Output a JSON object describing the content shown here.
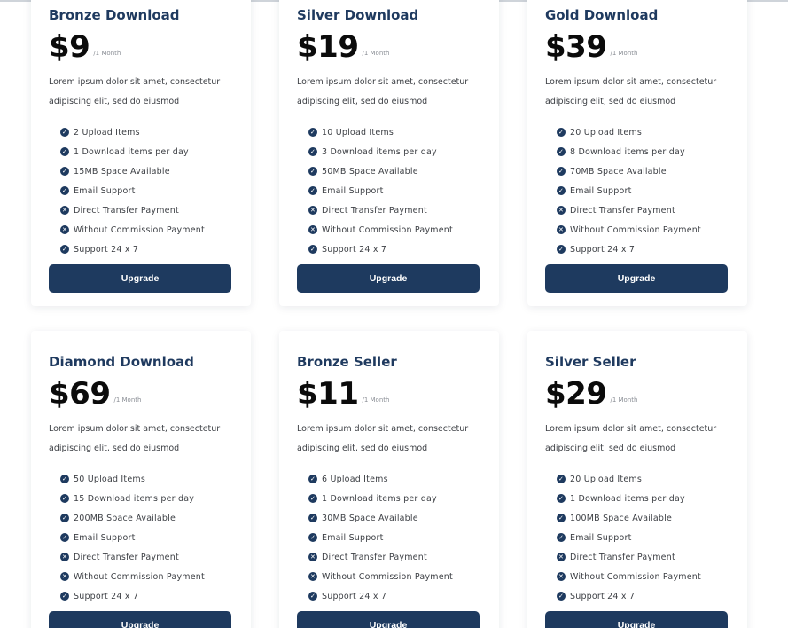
{
  "colors": {
    "primary": "#1e3a5f",
    "plan_name": "#1f3a5f",
    "price": "#0b0b0b",
    "muted": "#8b8f96"
  },
  "plans": [
    {
      "name": "Bronze Download",
      "price": "$9",
      "period": "/1 Month",
      "description": "Lorem ipsum dolor sit amet, consectetur adipiscing elit, sed do eiusmod",
      "button_label": "Upgrade",
      "features": [
        {
          "text": "2 Upload Items",
          "icon": "check-circle-icon"
        },
        {
          "text": "1 Download items per day",
          "icon": "check-circle-icon"
        },
        {
          "text": "15MB Space Available",
          "icon": "check-circle-icon"
        },
        {
          "text": "Email Support",
          "icon": "check-circle-icon"
        },
        {
          "text": "Direct Transfer Payment",
          "icon": "x-circle-icon"
        },
        {
          "text": "Without Commission Payment",
          "icon": "x-circle-icon"
        },
        {
          "text": "Support 24 x 7",
          "icon": "check-circle-icon"
        }
      ]
    },
    {
      "name": "Silver Download",
      "price": "$19",
      "period": "/1 Month",
      "description": "Lorem ipsum dolor sit amet, consectetur adipiscing elit, sed do eiusmod",
      "button_label": "Upgrade",
      "features": [
        {
          "text": "10 Upload Items",
          "icon": "check-circle-icon"
        },
        {
          "text": "3 Download items per day",
          "icon": "check-circle-icon"
        },
        {
          "text": "50MB Space Available",
          "icon": "check-circle-icon"
        },
        {
          "text": "Email Support",
          "icon": "check-circle-icon"
        },
        {
          "text": "Direct Transfer Payment",
          "icon": "x-circle-icon"
        },
        {
          "text": "Without Commission Payment",
          "icon": "x-circle-icon"
        },
        {
          "text": "Support 24 x 7",
          "icon": "check-circle-icon"
        }
      ]
    },
    {
      "name": "Gold Download",
      "price": "$39",
      "period": "/1 Month",
      "description": "Lorem ipsum dolor sit amet, consectetur adipiscing elit, sed do eiusmod",
      "button_label": "Upgrade",
      "features": [
        {
          "text": "20 Upload Items",
          "icon": "check-circle-icon"
        },
        {
          "text": "8 Download items per day",
          "icon": "check-circle-icon"
        },
        {
          "text": "70MB Space Available",
          "icon": "check-circle-icon"
        },
        {
          "text": "Email Support",
          "icon": "check-circle-icon"
        },
        {
          "text": "Direct Transfer Payment",
          "icon": "x-circle-icon"
        },
        {
          "text": "Without Commission Payment",
          "icon": "x-circle-icon"
        },
        {
          "text": "Support 24 x 7",
          "icon": "check-circle-icon"
        }
      ]
    },
    {
      "name": "Diamond Download",
      "price": "$69",
      "period": "/1 Month",
      "description": "Lorem ipsum dolor sit amet, consectetur adipiscing elit, sed do eiusmod",
      "button_label": "Upgrade",
      "features": [
        {
          "text": "50 Upload Items",
          "icon": "check-circle-icon"
        },
        {
          "text": "15 Download items per day",
          "icon": "check-circle-icon"
        },
        {
          "text": "200MB Space Available",
          "icon": "check-circle-icon"
        },
        {
          "text": "Email Support",
          "icon": "check-circle-icon"
        },
        {
          "text": "Direct Transfer Payment",
          "icon": "x-circle-icon"
        },
        {
          "text": "Without Commission Payment",
          "icon": "x-circle-icon"
        },
        {
          "text": "Support 24 x 7",
          "icon": "check-circle-icon"
        }
      ]
    },
    {
      "name": "Bronze Seller",
      "price": "$11",
      "period": "/1 Month",
      "description": "Lorem ipsum dolor sit amet, consectetur adipiscing elit, sed do eiusmod",
      "button_label": "Upgrade",
      "features": [
        {
          "text": "6 Upload Items",
          "icon": "check-circle-icon"
        },
        {
          "text": "1 Download items per day",
          "icon": "check-circle-icon"
        },
        {
          "text": "30MB Space Available",
          "icon": "check-circle-icon"
        },
        {
          "text": "Email Support",
          "icon": "check-circle-icon"
        },
        {
          "text": "Direct Transfer Payment",
          "icon": "x-circle-icon"
        },
        {
          "text": "Without Commission Payment",
          "icon": "x-circle-icon"
        },
        {
          "text": "Support 24 x 7",
          "icon": "check-circle-icon"
        }
      ]
    },
    {
      "name": "Silver Seller",
      "price": "$29",
      "period": "/1 Month",
      "description": "Lorem ipsum dolor sit amet, consectetur adipiscing elit, sed do eiusmod",
      "button_label": "Upgrade",
      "features": [
        {
          "text": "20 Upload Items",
          "icon": "check-circle-icon"
        },
        {
          "text": "1 Download items per day",
          "icon": "check-circle-icon"
        },
        {
          "text": "100MB Space Available",
          "icon": "check-circle-icon"
        },
        {
          "text": "Email Support",
          "icon": "check-circle-icon"
        },
        {
          "text": "Direct Transfer Payment",
          "icon": "x-circle-icon"
        },
        {
          "text": "Without Commission Payment",
          "icon": "x-circle-icon"
        },
        {
          "text": "Support 24 x 7",
          "icon": "check-circle-icon"
        }
      ]
    }
  ]
}
